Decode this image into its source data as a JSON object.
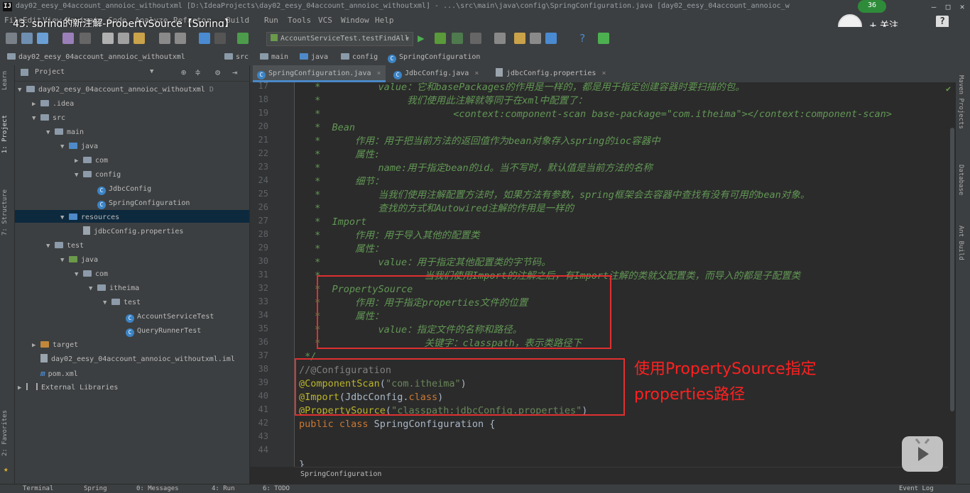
{
  "window": {
    "title": "day02_eesy_04account_annoioc_withoutxml [D:\\IdeaProjects\\day02_eesy_04account_annoioc_withoutxml] - ...\\src\\main\\java\\config\\SpringConfiguration.java [day02_eesy_04account_annoioc_w"
  },
  "video": {
    "title": "43. spring的新注解-PropertySource【Spring】",
    "badge": "36",
    "follow_label": "+ 关注",
    "help": "?"
  },
  "menu": [
    "File",
    "Edit",
    "View",
    "Navigate",
    "Code",
    "Analyze",
    "Refactor",
    "Build",
    "Run",
    "Tools",
    "VCS",
    "Window",
    "Help"
  ],
  "toolbar": {
    "run_config": "AccountServiceTest.testFindAll"
  },
  "breadcrumb": [
    "day02_eesy_04account_annoioc_withoutxml",
    "src",
    "main",
    "java",
    "config",
    "SpringConfiguration"
  ],
  "side_tabs": {
    "learn": "Learn",
    "project": "1: Project",
    "structure": "7: Structure",
    "favorites": "2: Favorites",
    "maven": "Maven Projects",
    "database": "Database",
    "ant": "Ant Build"
  },
  "project": {
    "header": "Project",
    "tree": [
      {
        "label": "day02_eesy_04account_annoioc_withoutxml",
        "suffix": "D",
        "depth": 0,
        "arrow": "▼",
        "icon": "folder"
      },
      {
        "label": ".idea",
        "depth": 1,
        "arrow": "▶",
        "icon": "folder"
      },
      {
        "label": "src",
        "depth": 1,
        "arrow": "▼",
        "icon": "folder"
      },
      {
        "label": "main",
        "depth": 2,
        "arrow": "▼",
        "icon": "folder"
      },
      {
        "label": "java",
        "depth": 3,
        "arrow": "▼",
        "icon": "folder-blue"
      },
      {
        "label": "com",
        "depth": 4,
        "arrow": "▶",
        "icon": "folder"
      },
      {
        "label": "config",
        "depth": 4,
        "arrow": "▼",
        "icon": "folder"
      },
      {
        "label": "JdbcConfig",
        "depth": 5,
        "arrow": "",
        "icon": "class"
      },
      {
        "label": "SpringConfiguration",
        "depth": 5,
        "arrow": "",
        "icon": "class"
      },
      {
        "label": "resources",
        "depth": 3,
        "arrow": "▼",
        "icon": "folder-blue"
      },
      {
        "label": "jdbcConfig.properties",
        "depth": 4,
        "arrow": "",
        "icon": "file"
      },
      {
        "label": "test",
        "depth": 2,
        "arrow": "▼",
        "icon": "folder"
      },
      {
        "label": "java",
        "depth": 3,
        "arrow": "▼",
        "icon": "folder-green"
      },
      {
        "label": "com",
        "depth": 4,
        "arrow": "▼",
        "icon": "folder"
      },
      {
        "label": "itheima",
        "depth": 5,
        "arrow": "▼",
        "icon": "folder"
      },
      {
        "label": "test",
        "depth": 6,
        "arrow": "▼",
        "icon": "folder"
      },
      {
        "label": "AccountServiceTest",
        "depth": 7,
        "arrow": "",
        "icon": "class"
      },
      {
        "label": "QueryRunnerTest",
        "depth": 7,
        "arrow": "",
        "icon": "class"
      },
      {
        "label": "target",
        "depth": 1,
        "arrow": "▶",
        "icon": "folder-orange"
      },
      {
        "label": "day02_eesy_04account_annoioc_withoutxml.iml",
        "depth": 1,
        "arrow": "",
        "icon": "file"
      },
      {
        "label": "pom.xml",
        "depth": 1,
        "arrow": "",
        "icon": "maven"
      },
      {
        "label": "External Libraries",
        "depth": 0,
        "arrow": "▶",
        "icon": "lib"
      }
    ]
  },
  "editor_tabs": [
    {
      "label": "SpringConfiguration.java",
      "active": true
    },
    {
      "label": "JdbcConfig.java",
      "active": false
    },
    {
      "label": "jdbcConfig.properties",
      "active": false
    }
  ],
  "code": {
    "line_numbers": [
      "17",
      "18",
      "19",
      "20",
      "21",
      "22",
      "23",
      "24",
      "25",
      "26",
      "27",
      "28",
      "29",
      "30",
      "31",
      "32",
      "33",
      "34",
      "35",
      "36",
      "37",
      "38",
      "39",
      "40",
      "41",
      "42",
      "43",
      "44"
    ],
    "lines": [
      "*          value：它和basePackages的作用是一样的，都是用于指定创建容器时要扫描的包。",
      "*               我们使用此注解就等同于在xml中配置了：",
      "*                       <context:component-scan base-package=\"com.itheima\"></context:component-scan>",
      "*  Bean",
      "*      作用：用于把当前方法的返回值作为bean对象存入spring的ioc容器中",
      "*      属性:",
      "*          name:用于指定bean的id。当不写时，默认值是当前方法的名称",
      "*      细节：",
      "*          当我们使用注解配置方法时，如果方法有参数，spring框架会去容器中查找有没有可用的bean对象。",
      "*          查找的方式和Autowired注解的作用是一样的",
      "*  Import",
      "*      作用：用于导入其他的配置类",
      "*      属性：",
      "*          value：用于指定其他配置类的字节码。",
      "*                  当我们使用Import的注解之后，有Import注解的类就父配置类，而导入的都是子配置类",
      "*  PropertySource",
      "*      作用：用于指定properties文件的位置",
      "*      属性：",
      "*          value：指定文件的名称和路径。",
      "*                  关键字：classpath，表示类路径下",
      "*/",
      "//@Configuration",
      "@ComponentScan(\"com.itheima\")",
      "@Import(JdbcConfig.class)",
      "@PropertySource(\"classpath:jdbcConfig.properties\")",
      "public class SpringConfiguration {",
      "",
      "",
      "}"
    ]
  },
  "annotation_note": [
    "使用PropertySource指定",
    "properties路径"
  ],
  "editor_breadcrumb": "SpringConfiguration",
  "bottom_tabs": [
    "Terminal",
    "Spring",
    "0: Messages",
    "4: Run",
    "6: TODO",
    "Event Log"
  ]
}
